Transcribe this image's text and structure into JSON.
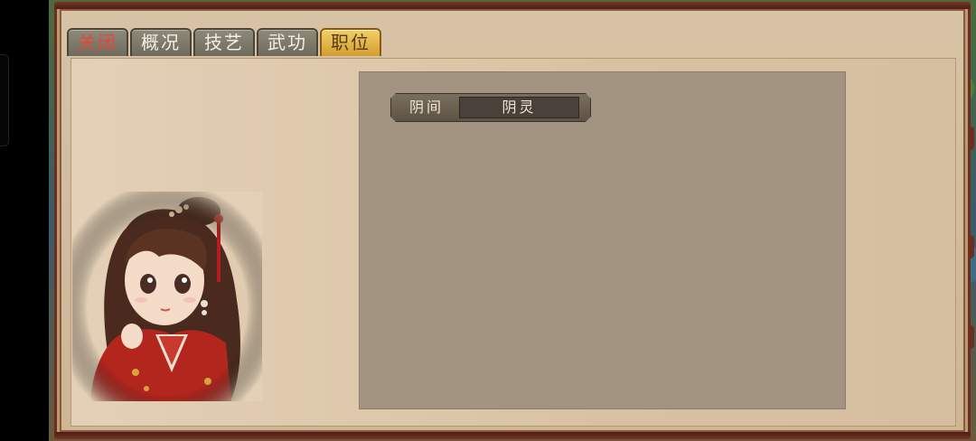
{
  "tabs": [
    {
      "label": "关闭",
      "state": "close"
    },
    {
      "label": "概况",
      "state": "normal"
    },
    {
      "label": "技艺",
      "state": "normal"
    },
    {
      "label": "武功",
      "state": "normal"
    },
    {
      "label": "职位",
      "state": "active"
    }
  ],
  "position": {
    "key": "阴间",
    "value": "阴灵"
  },
  "colors": {
    "frame": "#6b2f22",
    "panel": "#a29480",
    "active_tab": "#e2b548",
    "close_text": "#e8463c"
  }
}
